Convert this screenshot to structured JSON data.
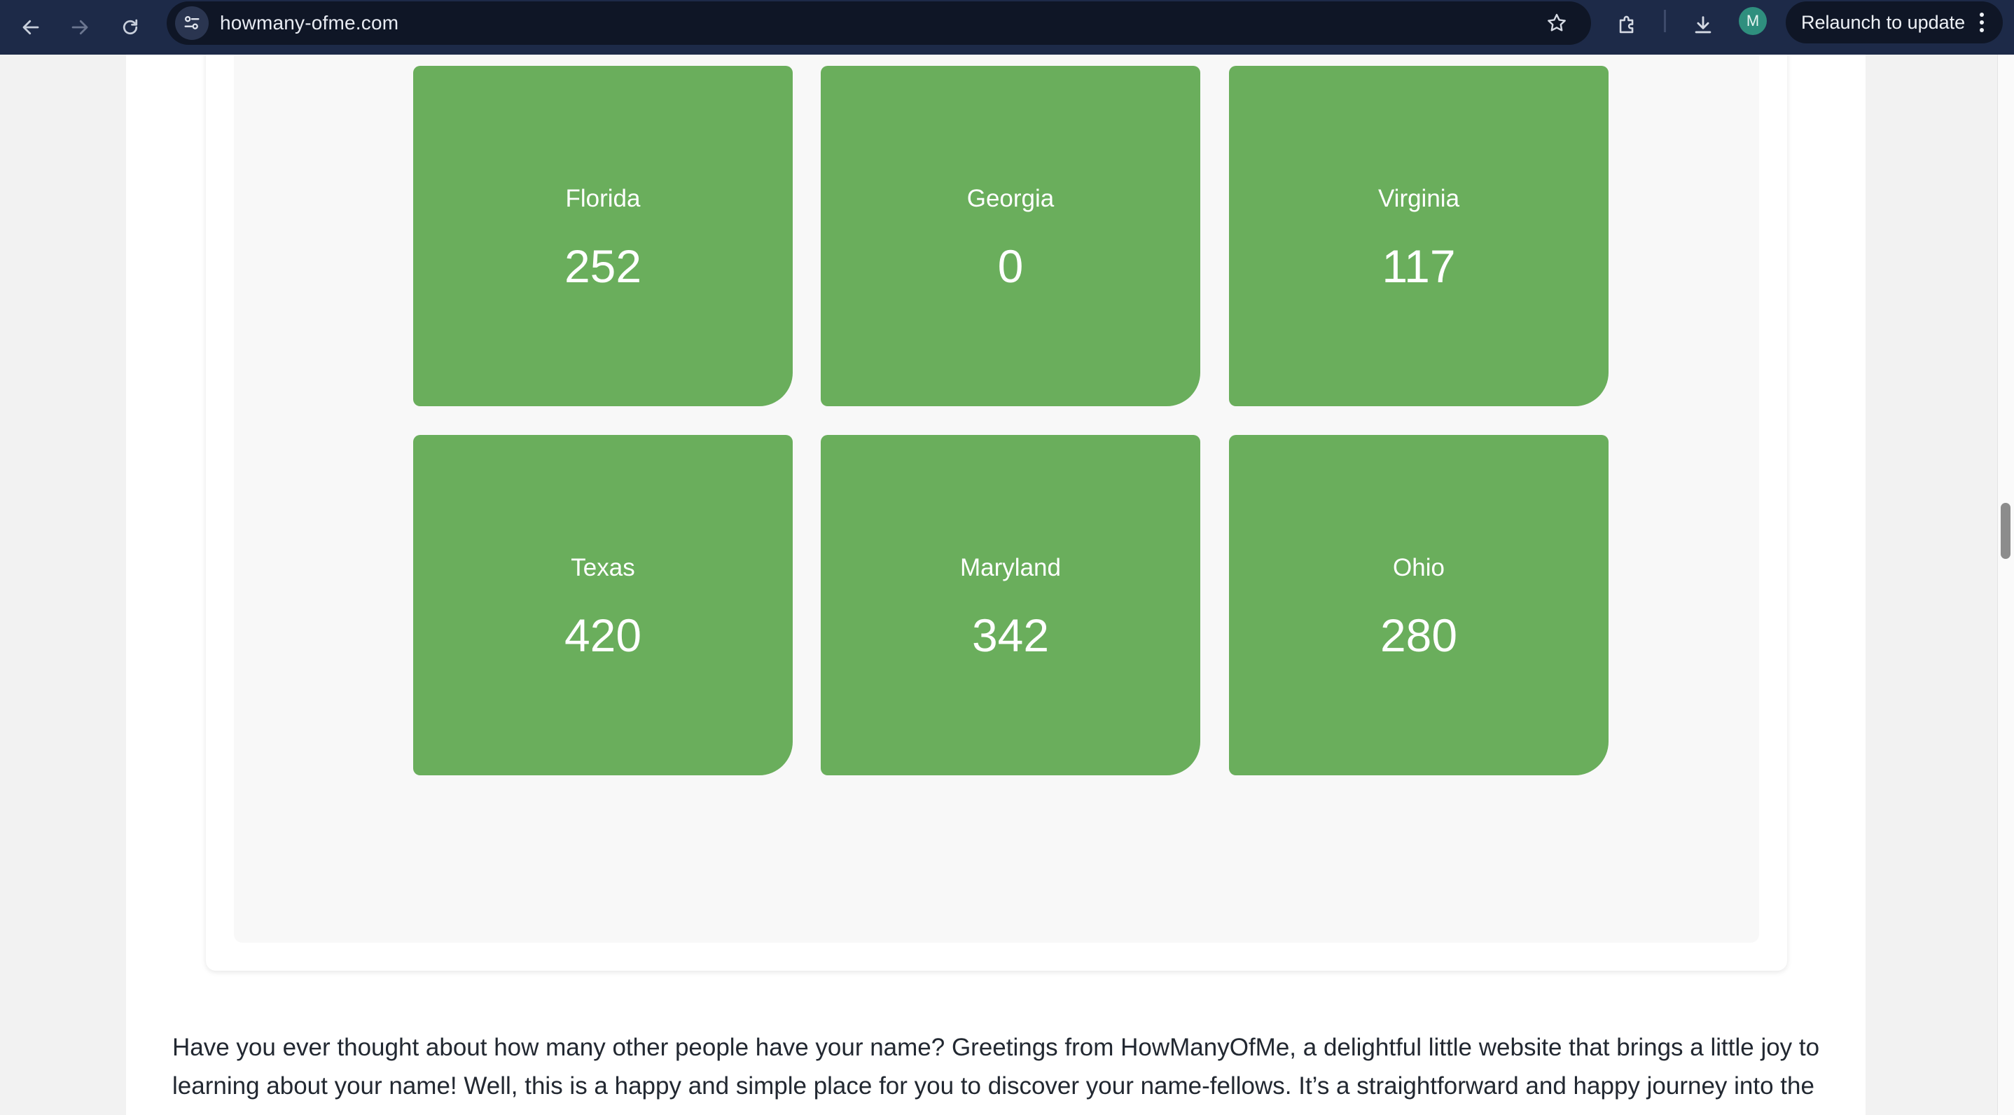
{
  "browser": {
    "url": "howmany-ofme.com",
    "relaunch_label": "Relaunch to update",
    "avatar_initial": "M",
    "icons": {
      "back": "back-arrow-icon",
      "forward": "forward-arrow-icon",
      "reload": "reload-icon",
      "site_info": "tune-icon",
      "bookmark": "star-icon",
      "extensions": "puzzle-icon",
      "downloads": "download-icon",
      "menu": "kebab-menu-icon"
    }
  },
  "states": [
    {
      "name": "Florida",
      "count": "252"
    },
    {
      "name": "Georgia",
      "count": "0"
    },
    {
      "name": "Virginia",
      "count": "117"
    },
    {
      "name": "Texas",
      "count": "420"
    },
    {
      "name": "Maryland",
      "count": "342"
    },
    {
      "name": "Ohio",
      "count": "280"
    }
  ],
  "intro": {
    "line1": "Have you ever thought about how many other people have your name? Greetings from HowManyOfMe, a delightful little website that brings a little joy to",
    "line2": "learning about your name! Well, this is a happy and simple place for you to discover your name-fellows. It’s a straightforward and happy journey into the"
  },
  "colors": {
    "tile": "#6aae5c",
    "chrome": "#1d2a48",
    "omnibox": "#0f1626"
  }
}
